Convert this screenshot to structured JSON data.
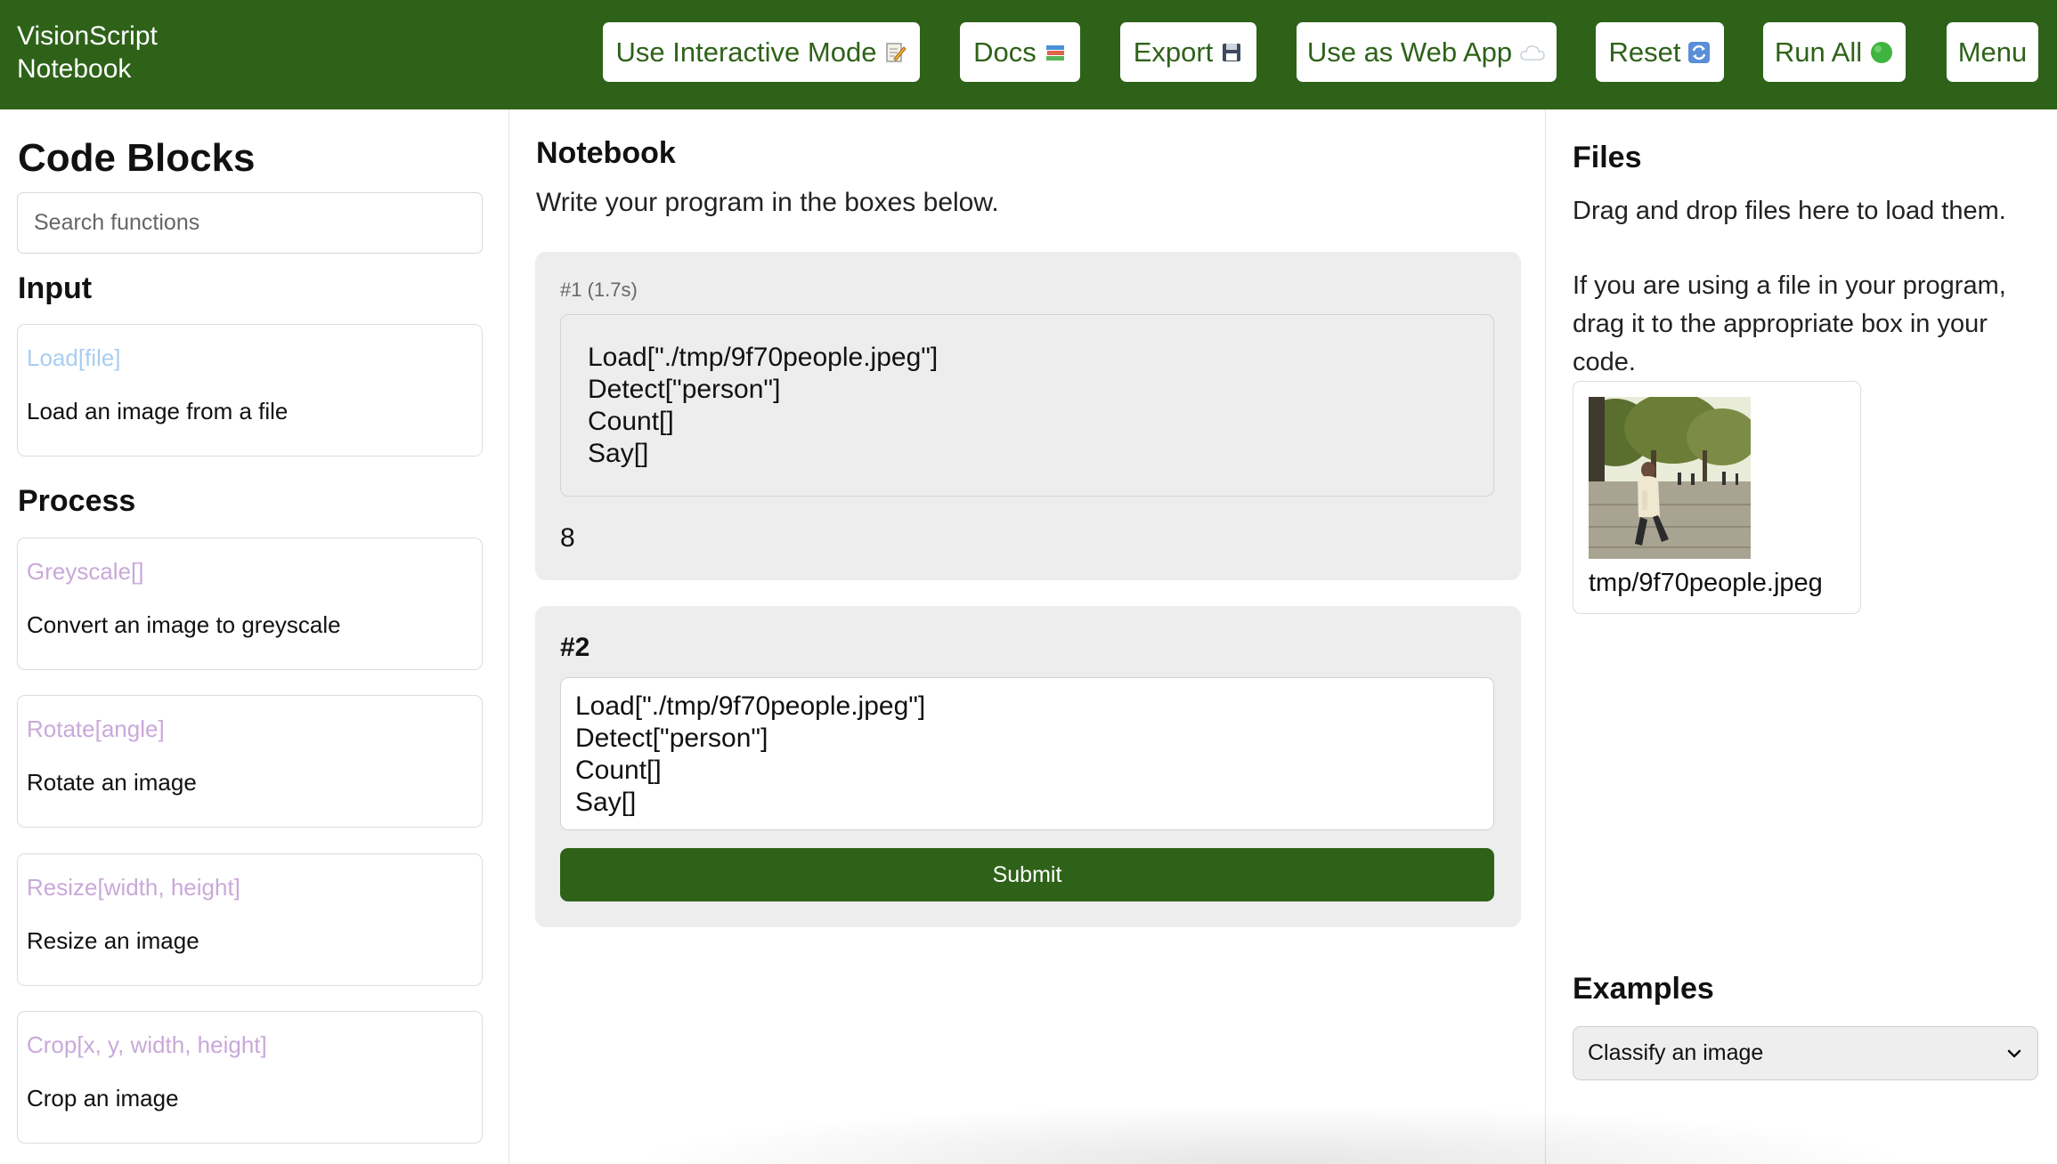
{
  "header": {
    "brand_line1": "VisionScript",
    "brand_line2": "Notebook",
    "buttons": {
      "interactive": "Use Interactive Mode",
      "docs": "Docs",
      "export": "Export",
      "webapp": "Use as Web App",
      "reset": "Reset",
      "run_all": "Run All",
      "menu": "Menu"
    },
    "icons": {
      "interactive": "memo-icon",
      "docs": "books-icon",
      "export": "floppy-disk-icon",
      "webapp": "cloud-icon",
      "reset": "refresh-icon",
      "run_all": "green-circle-icon"
    },
    "colors": {
      "bar": "#2e6219",
      "button_text": "#2e6219"
    }
  },
  "sidebar": {
    "title": "Code Blocks",
    "search_placeholder": "Search functions",
    "sections": {
      "input": "Input",
      "process": "Process"
    },
    "blocks": [
      {
        "fn": "Load[file]",
        "desc": "Load an image from a file",
        "color": "#a9cdf0"
      },
      {
        "fn": "Greyscale[]",
        "desc": "Convert an image to greyscale",
        "color": "#c9a9d9"
      },
      {
        "fn": "Rotate[angle]",
        "desc": "Rotate an image",
        "color": "#c9a9d9"
      },
      {
        "fn": "Resize[width, height]",
        "desc": "Resize an image",
        "color": "#c9a9d9"
      },
      {
        "fn": "Crop[x, y, width, height]",
        "desc": "Crop an image",
        "color": "#c9a9d9"
      }
    ]
  },
  "notebook": {
    "title": "Notebook",
    "subtitle": "Write your program in the boxes below.",
    "cell1": {
      "meta": "#1 (1.7s)",
      "code": "Load[\"./tmp/9f70people.jpeg\"]\nDetect[\"person\"]\nCount[]\nSay[]",
      "output": "8"
    },
    "cell2": {
      "title": "#2",
      "code": "Load[\"./tmp/9f70people.jpeg\"]\nDetect[\"person\"]\nCount[]\nSay[]",
      "submit": "Submit"
    }
  },
  "files": {
    "title": "Files",
    "text1": "Drag and drop files here to load them.",
    "text2": "If you are using a file in your program, drag it to the appropriate box in your code.",
    "file_name": "tmp/9f70people.jpeg"
  },
  "examples": {
    "title": "Examples",
    "selected": "Classify an image"
  }
}
